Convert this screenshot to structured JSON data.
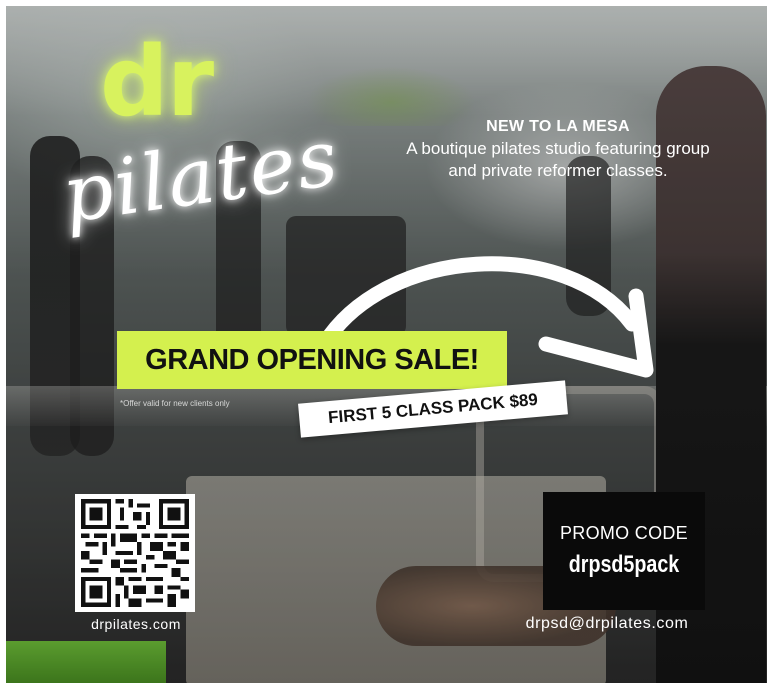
{
  "logo": {
    "primary": "dr",
    "secondary": "pilates"
  },
  "intro": {
    "headline": "NEW TO LA MESA",
    "body": "A boutique pilates studio featuring group and private reformer classes."
  },
  "sale": {
    "headline": "GRAND OPENING SALE!",
    "offer": "FIRST 5 CLASS PACK $89",
    "fineprint": "*Offer valid for new clients only"
  },
  "qr": {
    "icon": "qr-code-icon",
    "url": "drpilates.com"
  },
  "promo": {
    "label": "PROMO CODE",
    "code": "drpsd5pack"
  },
  "contact": {
    "email": "drpsd@drpilates.com"
  },
  "colors": {
    "accent_lime": "#d4f04e",
    "neon_lime": "#d8f25e",
    "white": "#ffffff",
    "black": "#0a0a0a"
  }
}
